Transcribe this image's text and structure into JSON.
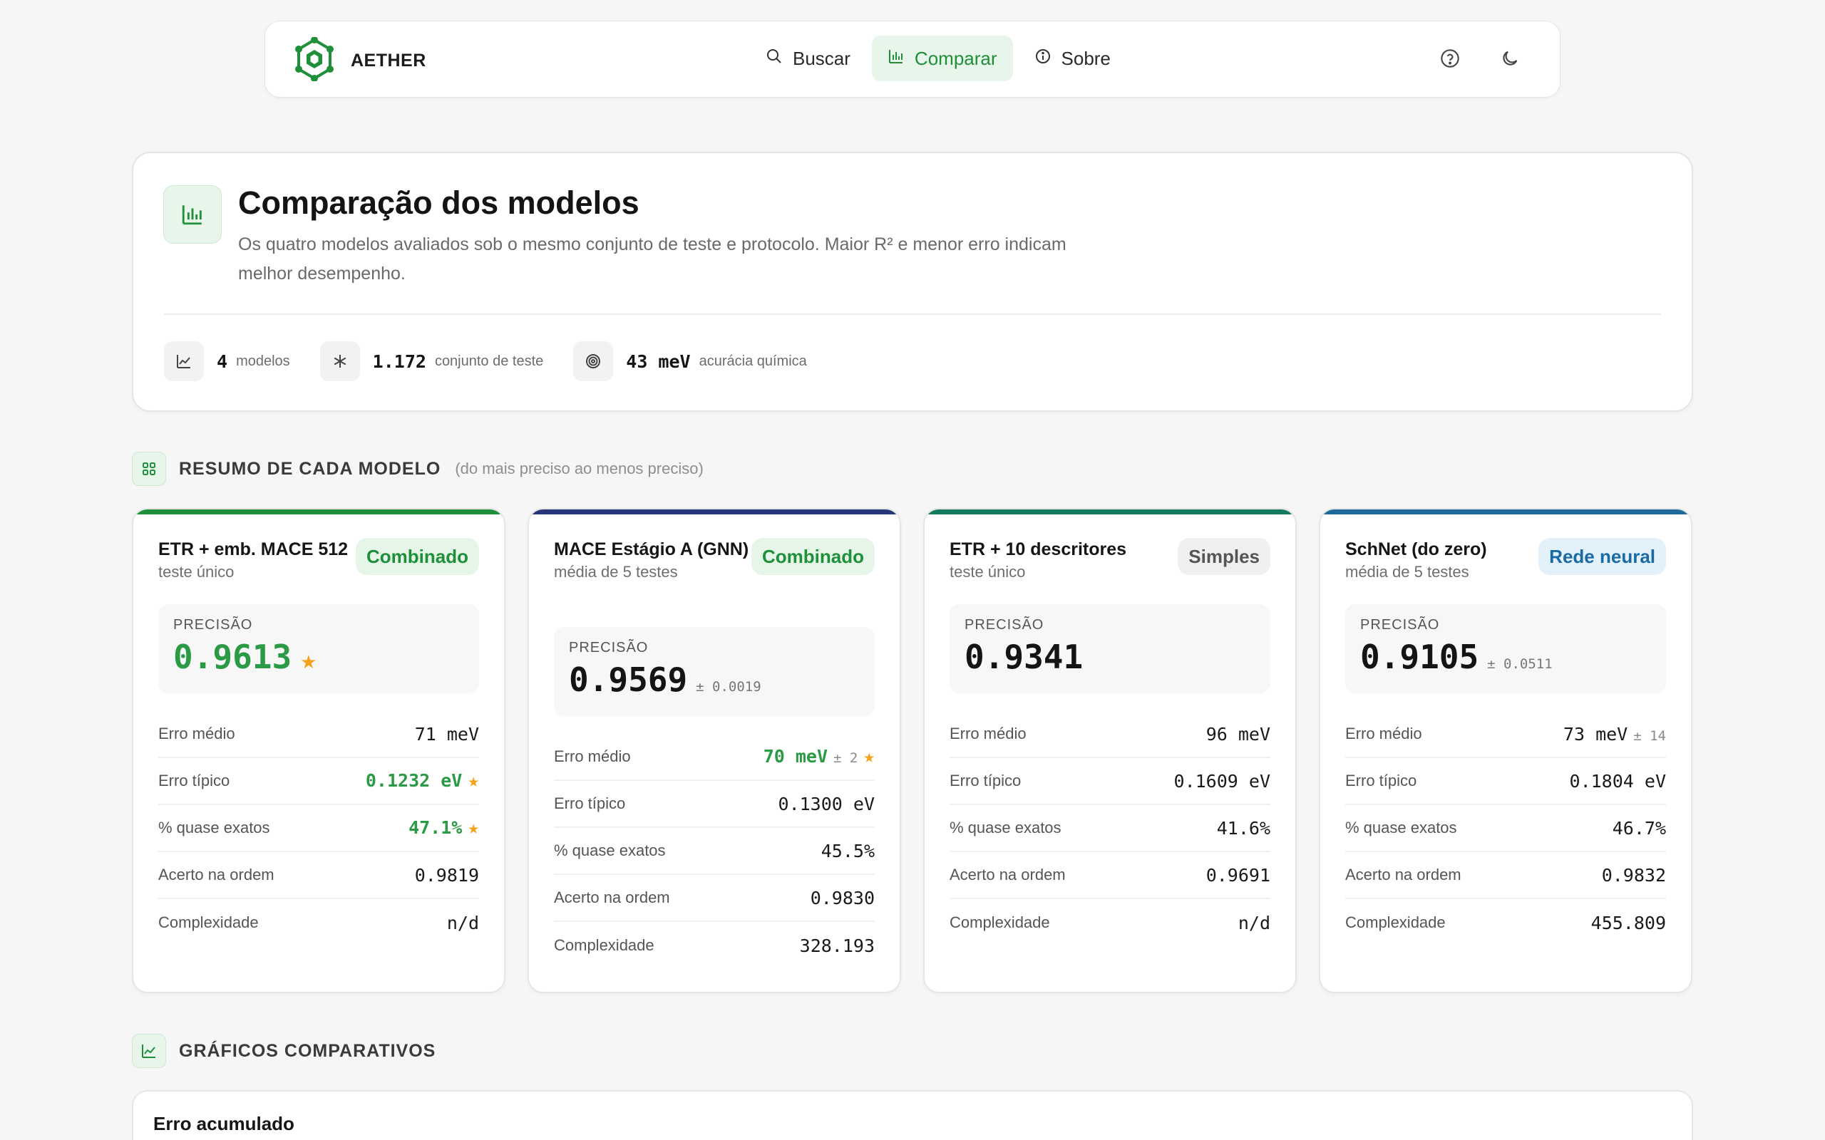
{
  "nav": {
    "brand": "AETHER",
    "links": [
      {
        "label": "Buscar"
      },
      {
        "label": "Comparar"
      },
      {
        "label": "Sobre"
      }
    ]
  },
  "hero": {
    "title": "Comparação dos modelos",
    "description": "Os quatro modelos avaliados sob o mesmo conjunto de teste e protocolo. Maior R² e menor erro indicam melhor desempenho.",
    "stats": [
      {
        "value": "4",
        "label": "modelos"
      },
      {
        "value": "1.172",
        "label": "conjunto de teste"
      },
      {
        "value": "43 meV",
        "label": "acurácia química"
      }
    ]
  },
  "summary": {
    "title": "RESUMO DE CADA MODELO",
    "subtitle": "(do mais preciso ao menos preciso)"
  },
  "metric_labels": {
    "erro_medio": "Erro médio",
    "erro_tipico": "Erro típico",
    "quase_exatos": "% quase exatos",
    "acerto_ordem": "Acerto na ordem",
    "complexidade": "Complexidade",
    "precisao": "PRECISÃO"
  },
  "models": [
    {
      "name": "ETR + emb. MACE 512",
      "subtitle": "teste único",
      "badge": "Combinado",
      "accent": "#1f8f3a",
      "precision": "0.9613",
      "precision_pm": "",
      "erro_medio": "71 meV",
      "erro_medio_pm": "",
      "erro_tipico": "0.1232 eV",
      "quase_exatos": "47.1%",
      "acerto_ordem": "0.9819",
      "complexidade": "n/d"
    },
    {
      "name": "MACE Estágio A (GNN)",
      "subtitle": "média de 5 testes",
      "badge": "Combinado",
      "accent": "#27377a",
      "precision": "0.9569",
      "precision_pm": "± 0.0019",
      "erro_medio": "70 meV",
      "erro_medio_pm": "± 2",
      "erro_tipico": "0.1300 eV",
      "quase_exatos": "45.5%",
      "acerto_ordem": "0.9830",
      "complexidade": "328.193"
    },
    {
      "name": "ETR + 10 descritores",
      "subtitle": "teste único",
      "badge": "Simples",
      "accent": "#157a5e",
      "precision": "0.9341",
      "precision_pm": "",
      "erro_medio": "96 meV",
      "erro_medio_pm": "",
      "erro_tipico": "0.1609 eV",
      "quase_exatos": "41.6%",
      "acerto_ordem": "0.9691",
      "complexidade": "n/d"
    },
    {
      "name": "SchNet (do zero)",
      "subtitle": "média de 5 testes",
      "badge": "Rede neural",
      "accent": "#1d6a98",
      "precision": "0.9105",
      "precision_pm": "± 0.0511",
      "erro_medio": "73 meV",
      "erro_medio_pm": "± 14",
      "erro_tipico": "0.1804 eV",
      "quase_exatos": "46.7%",
      "acerto_ordem": "0.9832",
      "complexidade": "455.809"
    }
  ],
  "charts": {
    "title": "GRÁFICOS COMPARATIVOS",
    "first_chart_title": "Erro acumulado"
  },
  "colors": {
    "accent_green": "#1f8f3a",
    "best_green": "#2a9a44",
    "star": "#f4a21c"
  }
}
